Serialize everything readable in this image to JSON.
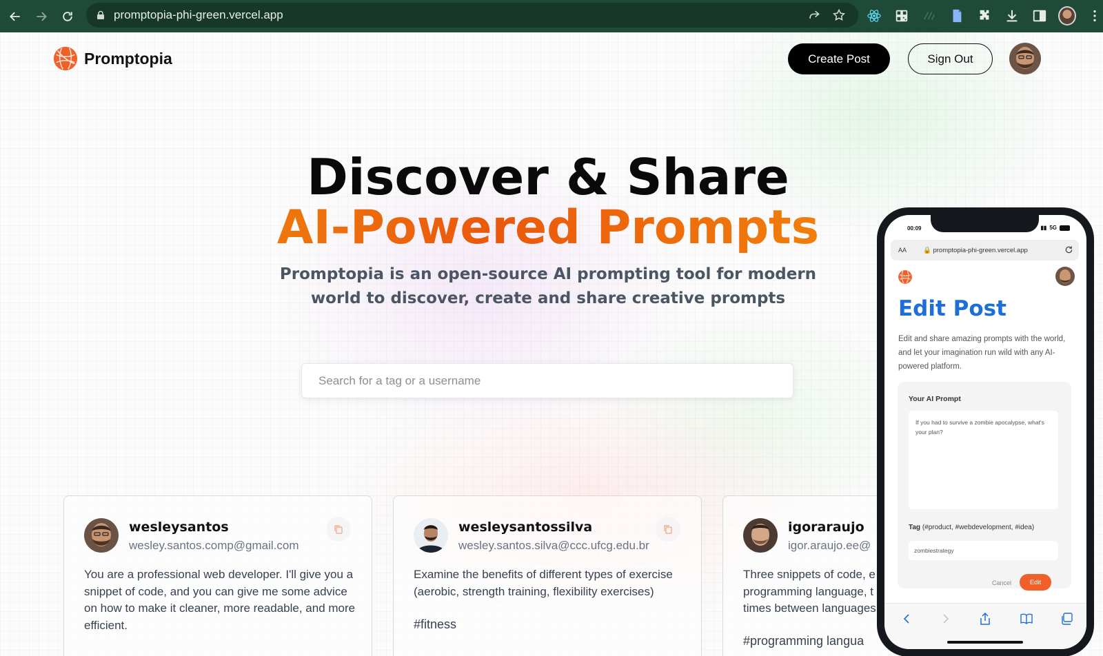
{
  "browser": {
    "url": "promptopia-phi-green.vercel.app"
  },
  "nav": {
    "brand": "Promptopia",
    "create_post": "Create Post",
    "sign_out": "Sign Out"
  },
  "hero": {
    "title_line1": "Discover & Share",
    "title_line2": "AI-Powered Prompts",
    "description": "Promptopia is an open-source AI prompting tool for modern world to discover, create and share creative prompts"
  },
  "search": {
    "placeholder": "Search for a tag or a username"
  },
  "cards": [
    {
      "username": "wesleysantos",
      "email": "wesley.santos.comp@gmail.com",
      "prompt": "You are a professional web developer. I'll give you a snippet of code, and you can give me some advice on how to make it cleaner, more readable, and more efficient.",
      "tag": ""
    },
    {
      "username": "wesleysantossilva",
      "email": "wesley.santos.silva@ccc.ufcg.edu.br",
      "prompt": "Examine the benefits of different types of exercise (aerobic, strength training, flexibility exercises)",
      "tag": "#fitness"
    },
    {
      "username": "igoraraujo",
      "email": "igor.araujo.ee@",
      "prompt": "Three snippets of code, e programming language, t times between languages",
      "tag": "#programming langua"
    }
  ],
  "phone": {
    "time": "00:09",
    "signal": "5G",
    "aa": "AA",
    "url": "promptopia-phi-green.vercel.app",
    "title": "Edit Post",
    "description": "Edit and share amazing prompts with the world, and let your imagination run wild with any AI-powered platform.",
    "prompt_label": "Your AI Prompt",
    "prompt_value": "If you had to survive a zombie apocalypse, what's your plan?",
    "tag_label": "Tag",
    "tag_hint": "(#product, #webdevelopment, #idea)",
    "tag_value": "zombiestrategy",
    "cancel": "Cancel",
    "edit": "Edit"
  },
  "colors": {
    "browser_bar": "#1f4a37",
    "accent_orange": "#f0612a",
    "edit_title_blue": "#1d6fd8"
  }
}
